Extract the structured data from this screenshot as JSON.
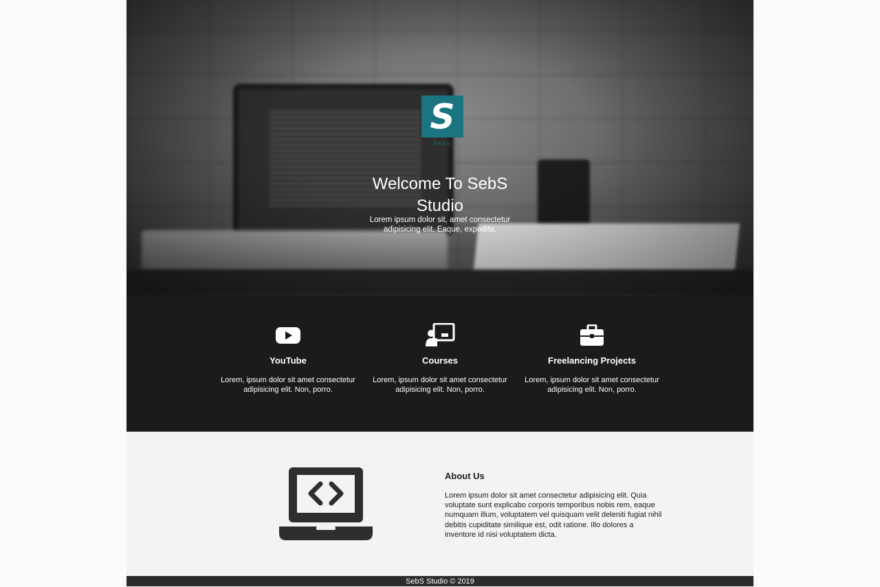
{
  "hero": {
    "logo_letter": "S",
    "logo_caption": "SebS",
    "title": "Welcome To SebS Studio",
    "subtitle": "Lorem ipsum dolor sit, amet consectetur adipisicing elit. Eaque, expedita."
  },
  "services": [
    {
      "icon": "youtube-icon",
      "title": "YouTube",
      "desc": "Lorem, ipsum dolor sit amet consectetur adipisicing elit. Non, porro."
    },
    {
      "icon": "presentation-icon",
      "title": "Courses",
      "desc": "Lorem, ipsum dolor sit amet consectetur adipisicing elit. Non, porro."
    },
    {
      "icon": "briefcase-icon",
      "title": "Freelancing Projects",
      "desc": "Lorem, ipsum dolor sit amet consectetur adipisicing elit. Non, porro."
    }
  ],
  "about": {
    "icon": "laptop-code-icon",
    "title": "About Us",
    "text": "Lorem ipsum dolor sit amet consectetur adipisicing elit. Quia voluptate sunt explicabo corporis temporibus nobis rem, eaque numquam illum, voluptatem vel quisquam velit deleniti fugiat nihil debitis cupiditate similique est, odit ratione. Illo dolores a inventore id nisi voluptatem dicta."
  },
  "footer": {
    "text": "SebS Studio © 2019"
  },
  "colors": {
    "brand": "#1b7580",
    "dark": "#1b1b1b",
    "light": "#f3f3f3"
  }
}
